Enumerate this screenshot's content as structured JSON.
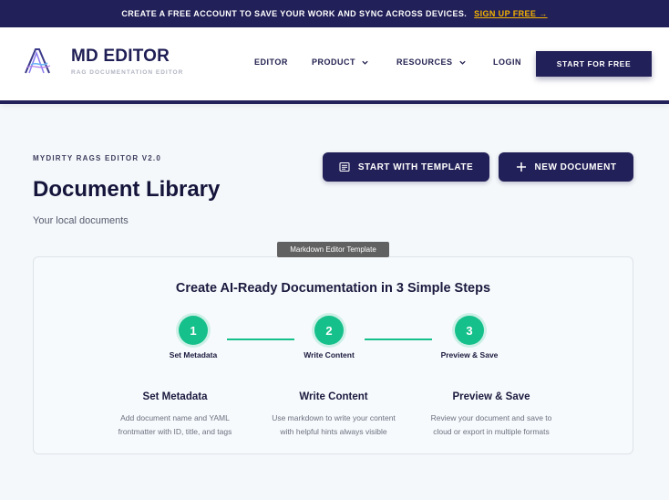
{
  "promo": {
    "text": "CREATE A FREE ACCOUNT TO SAVE YOUR WORK AND SYNC ACROSS DEVICES.",
    "link": "SIGN UP FREE →"
  },
  "header": {
    "brand": "MD EDITOR",
    "tagline": "RAG DOCUMENTATION EDITOR",
    "nav": {
      "editor": "EDITOR",
      "product": "PRODUCT",
      "resources": "RESOURCES",
      "login": "LOGIN"
    },
    "cta": "START FOR FREE"
  },
  "page": {
    "eyebrow": "MYDIRTY RAGS EDITOR V2.0",
    "title": "Document Library",
    "subtitle": "Your local documents",
    "actions": {
      "template": "START WITH TEMPLATE",
      "new_doc": "NEW DOCUMENT"
    }
  },
  "tooltip": "Markdown Editor Template",
  "steps": {
    "title": "Create AI-Ready Documentation in 3 Simple Steps",
    "items": [
      {
        "number": "1",
        "label": "Set Metadata",
        "heading": "Set Metadata",
        "desc_line1": "Add document name and YAML",
        "desc_line2": "frontmatter with ID, title, and tags"
      },
      {
        "number": "2",
        "label": "Write Content",
        "heading": "Write Content",
        "desc_line1": "Use markdown to write your content",
        "desc_line2": "with helpful hints always visible"
      },
      {
        "number": "3",
        "label": "Preview & Save",
        "heading": "Preview & Save",
        "desc_line1": "Review your document and save to",
        "desc_line2": "cloud or export in multiple formats"
      }
    ]
  },
  "colors": {
    "navy": "#222058",
    "accent_yellow": "#f5b300",
    "step_green": "#16c08a"
  }
}
